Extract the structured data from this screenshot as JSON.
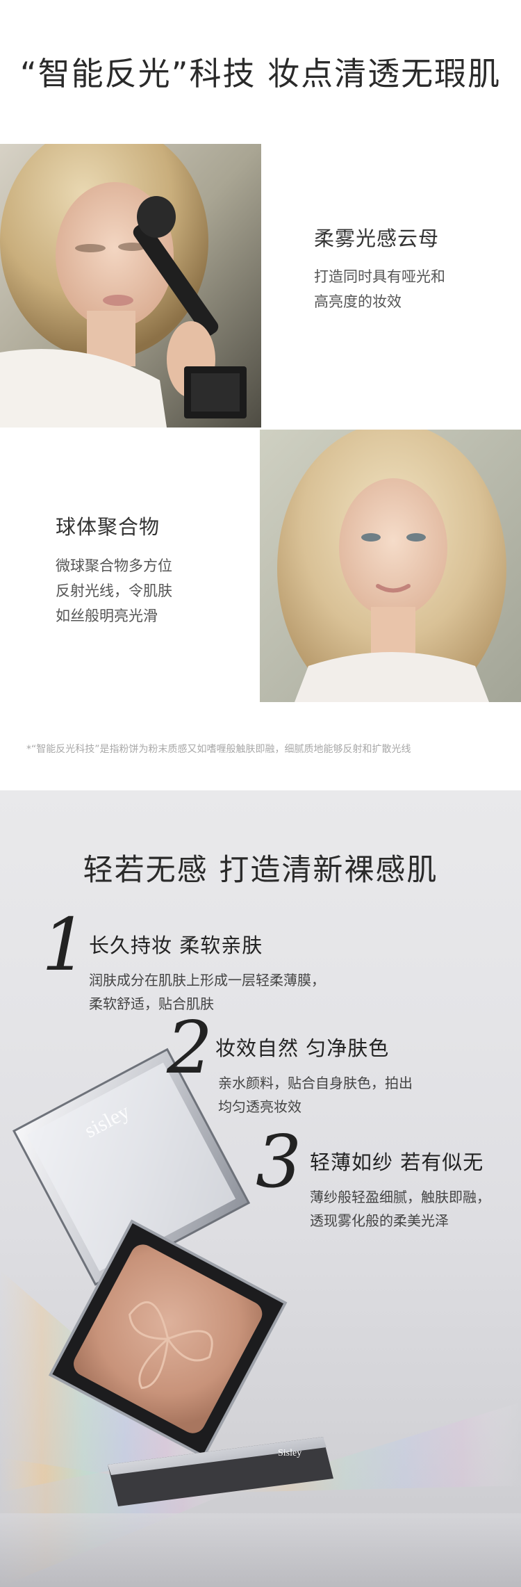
{
  "hero": {
    "title": "“智能反光”科技  妆点清透无瑕肌"
  },
  "features": [
    {
      "title": "柔雾光感云母",
      "lines": [
        "打造同时具有哑光和",
        "高亮度的妆效"
      ]
    },
    {
      "title": "球体聚合物",
      "lines": [
        "微球聚合物多方位",
        "反射光线，令肌肤",
        "如丝般明亮光滑"
      ]
    }
  ],
  "footnote": "*“智能反光科技”是指粉饼为粉末质感又如嗜喱般触肤即融，细腻质地能够反射和扩散光线",
  "section2": {
    "title": "轻若无感  打造清新裸感肌",
    "points": [
      {
        "number": "1",
        "title": "长久持妆  柔软亲肤",
        "lines": [
          "润肤成分在肌肤上形成一层轻柔薄膜，",
          "柔软舒适，贴合肌肤"
        ]
      },
      {
        "number": "2",
        "title": "妆效自然  匀净肤色",
        "lines": [
          "亲水颜料，贴合自身肤色，拍出",
          "均匀透亮妆效"
        ]
      },
      {
        "number": "3",
        "title": "轻薄如纱  若有似无",
        "lines": [
          "薄纱般轻盈细腻，触肤即融，",
          "透现雾化般的柔美光泽"
        ]
      }
    ],
    "product": {
      "lid_brand": "sisley",
      "base_brand": "Sisley"
    }
  },
  "colors": {
    "text_dark": "#2a2a2a",
    "text_body": "#555555",
    "footnote": "#a8a8a8",
    "powder": "#c8937a"
  }
}
